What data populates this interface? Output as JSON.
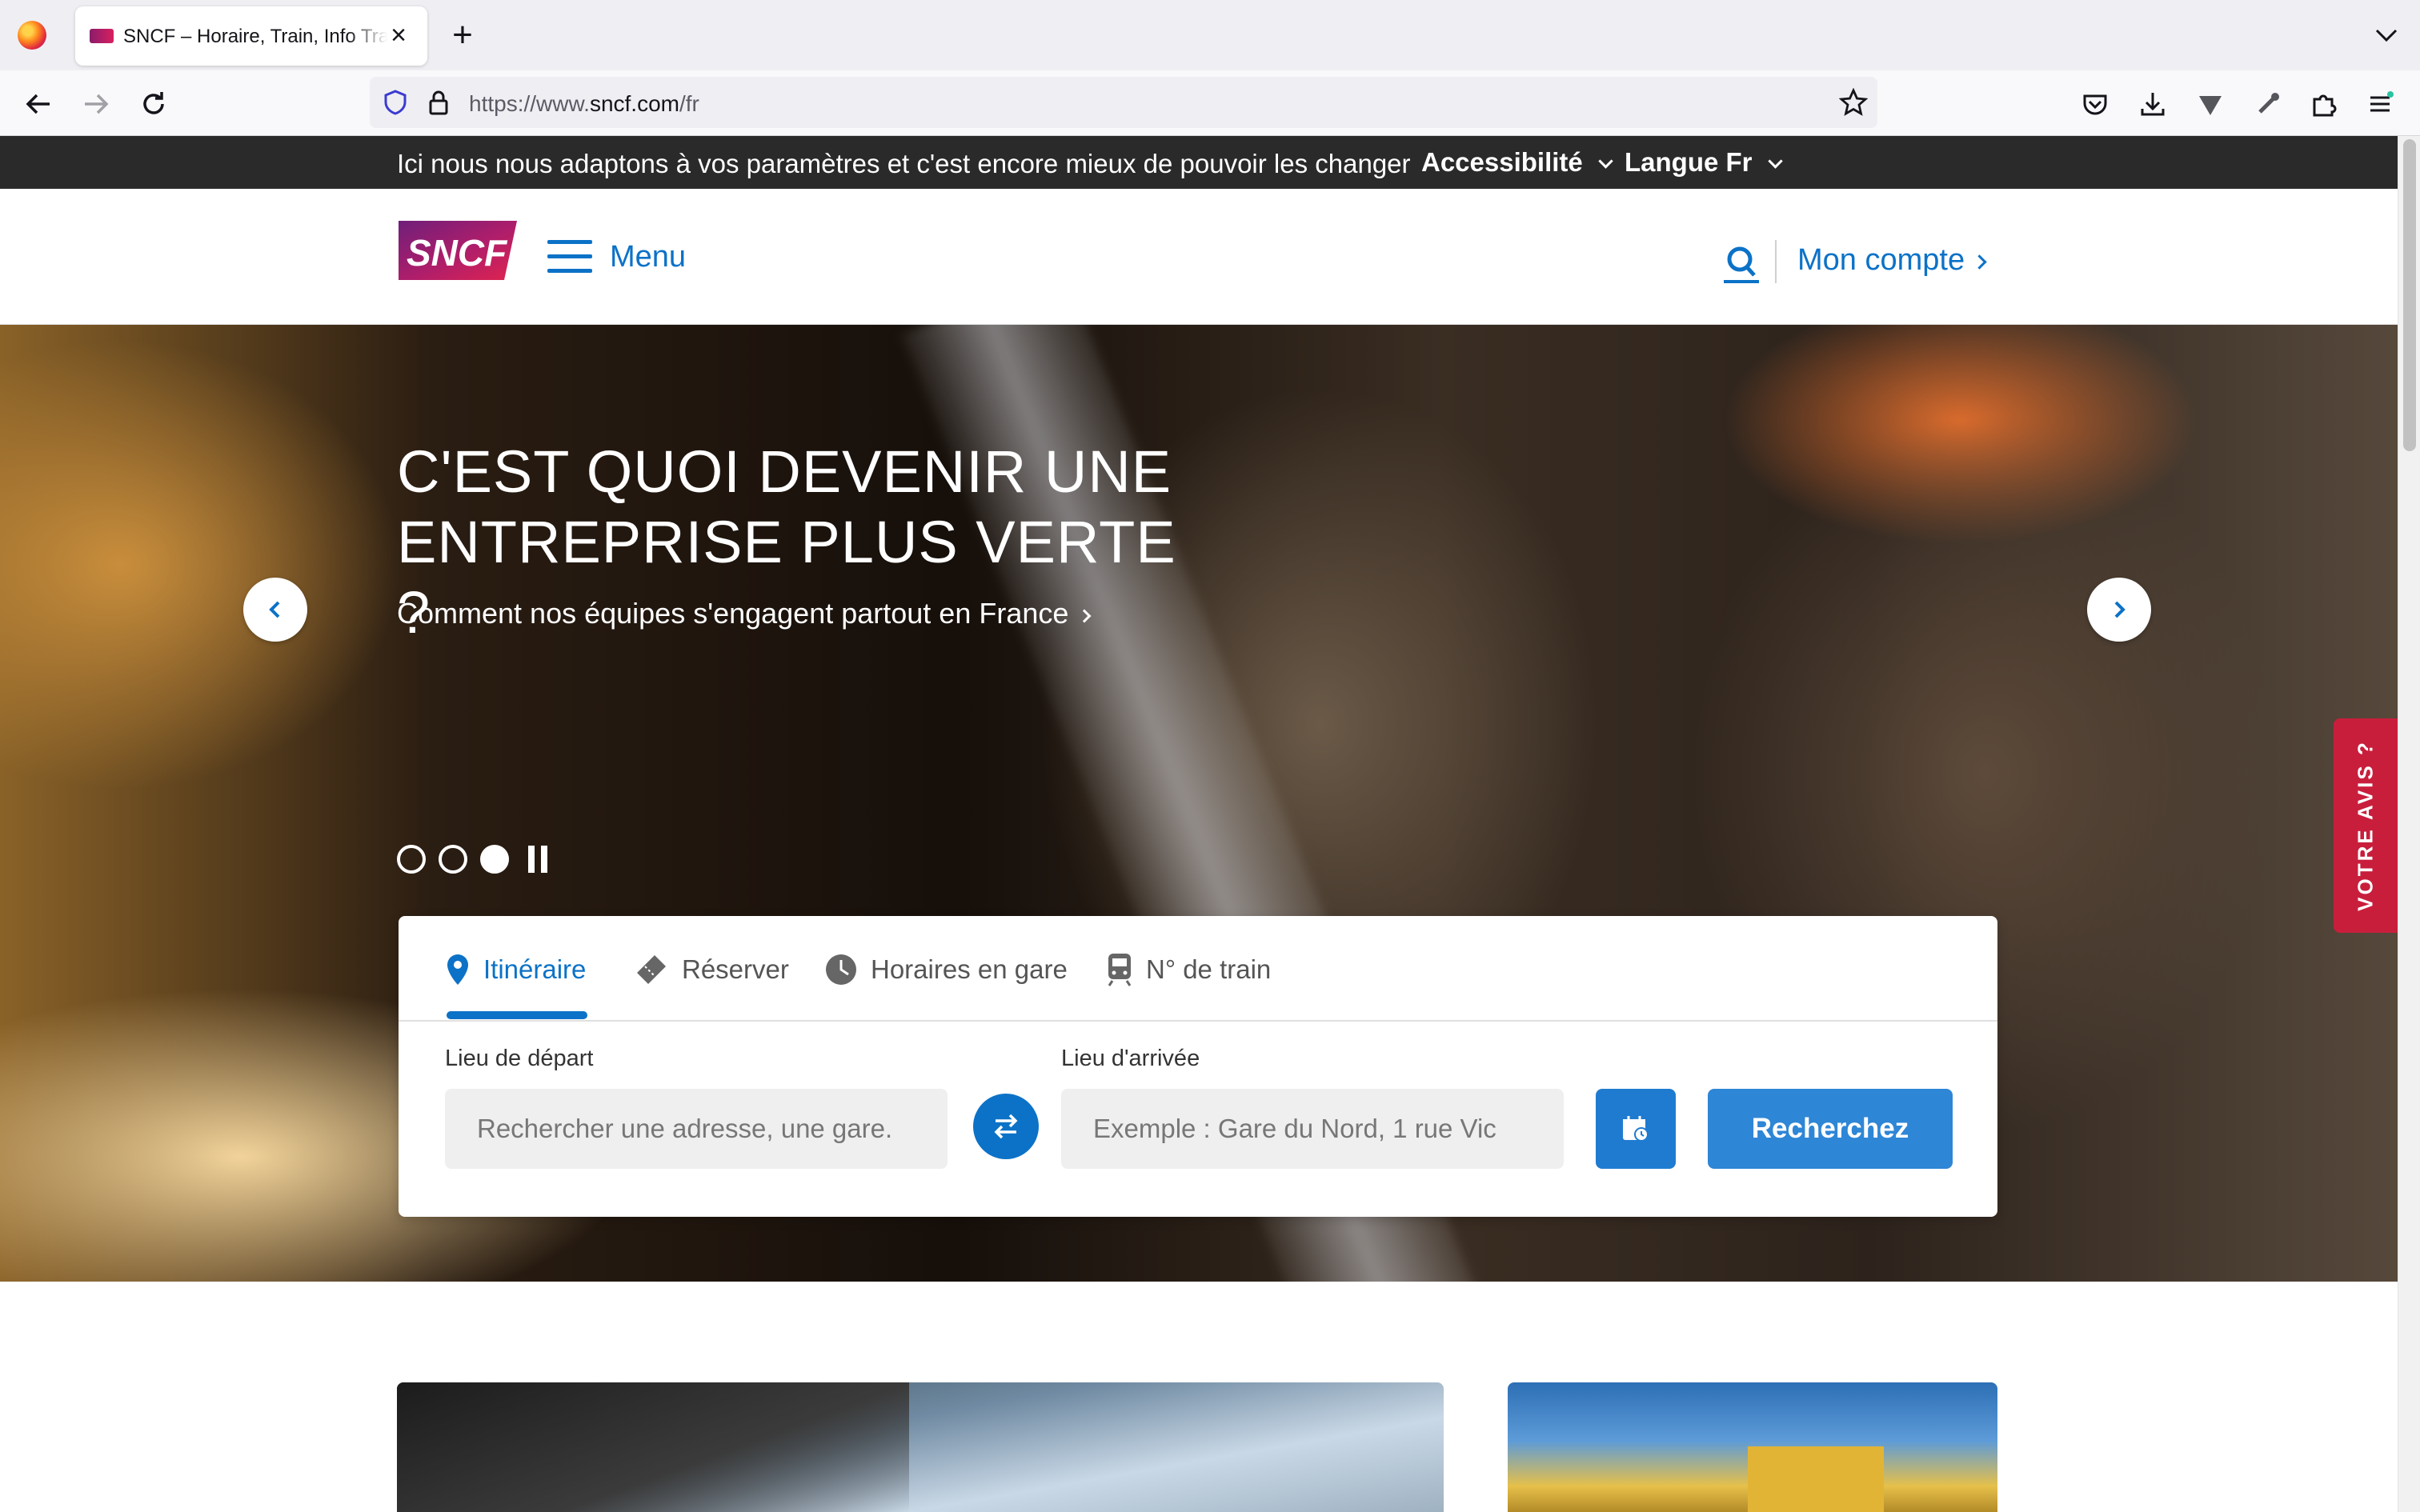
{
  "browser": {
    "tab_title": "SNCF – Horaire, Train, Info Trafic",
    "url_prefix": "https://www.",
    "url_domain": "sncf.com",
    "url_path": "/fr"
  },
  "top_banner": {
    "message": "Ici nous nous adaptons à vos paramètres et c'est encore mieux de pouvoir les changer",
    "accessibility": "Accessibilité",
    "language": "Langue Fr"
  },
  "header": {
    "logo_text": "SNCF",
    "menu_label": "Menu",
    "account_label": "Mon compte"
  },
  "hero": {
    "title": "C'EST QUOI DEVENIR UNE ENTREPRISE PLUS VERTE ?",
    "subtitle": "Comment nos équipes s'engagent partout en France",
    "slides_total": 3,
    "active_slide": 3
  },
  "search": {
    "tabs": [
      {
        "label": "Itinéraire",
        "active": true
      },
      {
        "label": "Réserver",
        "active": false
      },
      {
        "label": "Horaires en gare",
        "active": false
      },
      {
        "label": "N° de train",
        "active": false
      }
    ],
    "departure_label": "Lieu de départ",
    "departure_placeholder": "Rechercher une adresse, une gare.",
    "arrival_label": "Lieu d'arrivée",
    "arrival_placeholder": "Exemple : Gare du Nord, 1 rue Vic",
    "submit_label": "Recherchez"
  },
  "feedback_label": "VOTRE AVIS ?",
  "colors": {
    "brand_blue": "#0c72c7",
    "feedback_red": "#c81e3c",
    "banner_dark": "#2a2a2a"
  }
}
